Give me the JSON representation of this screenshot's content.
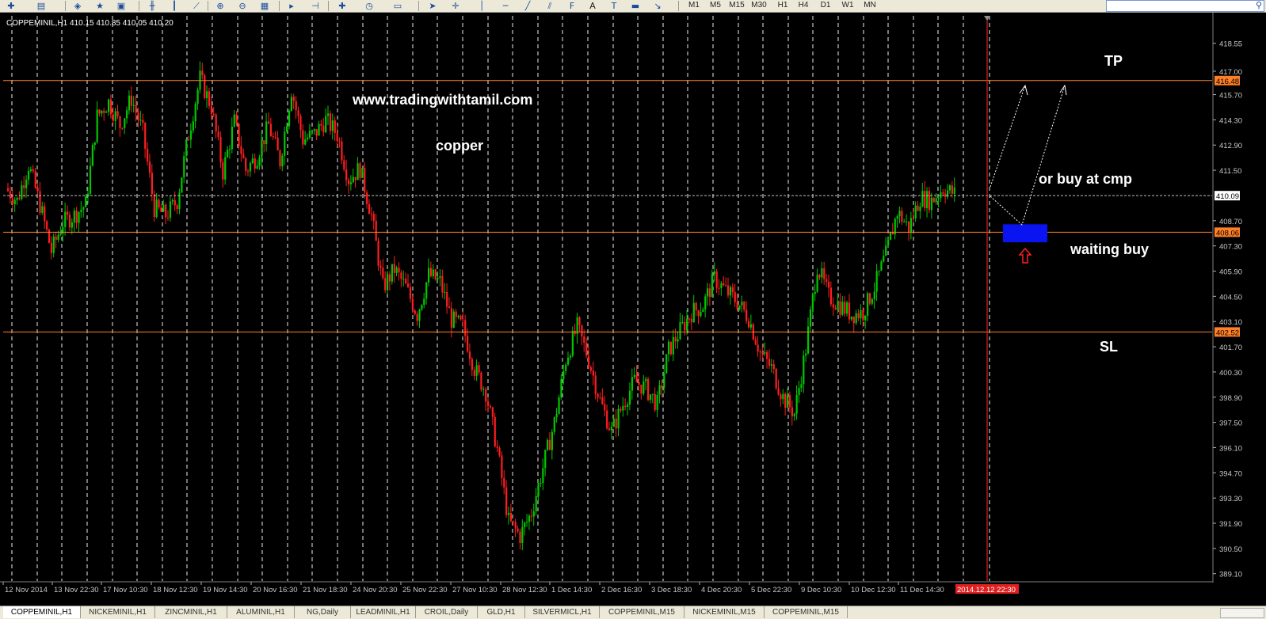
{
  "toolbar": {
    "timeframes": [
      "M1",
      "M5",
      "M15",
      "M30",
      "H1",
      "H4",
      "D1",
      "W1",
      "MN"
    ],
    "icons": [
      "new-chart-icon",
      "profiles-icon",
      "market-watch-icon",
      "favorites-icon",
      "navigator-icon",
      "bar-chart-icon",
      "candle-chart-icon",
      "line-chart-icon",
      "zoom-in-icon",
      "zoom-out-icon",
      "tile-icon",
      "auto-scroll-icon",
      "chart-shift-icon",
      "indicators-icon",
      "periods-icon",
      "templates-icon",
      "cursor-icon",
      "crosshair-icon",
      "vertical-line-icon",
      "horizontal-line-icon",
      "trendline-icon",
      "equidistant-channel-icon",
      "fibonacci-icon",
      "text-icon",
      "text-label-icon",
      "rectangle-icon",
      "arrows-icon"
    ],
    "text_tool_label": "A",
    "fib_label": "F"
  },
  "chart": {
    "info_label": "COPPEMINIL,H1  410.15 410.85 410.05 410.20",
    "colors": {
      "background": "#000000",
      "bull_candle": "#00c800",
      "bear_candle": "#ff1e1e",
      "grid": "#d8d8d8",
      "level_line": "#ff7f27",
      "bid_line": "#c0c0c0",
      "period_separator": "#dd2020",
      "entry_zone": "#0a14f0",
      "axis_text": "#c8c8c8",
      "axis_bg": "#000000",
      "price_marker_bg": "#ff7f27",
      "bid_marker_bg": "#ffffff",
      "time_marker_bg": "#e02020"
    },
    "y_axis": {
      "min": 388.9,
      "max": 419.6,
      "ticks": [
        "418.55",
        "417.00",
        "415.70",
        "414.30",
        "412.90",
        "411.50",
        "410.09",
        "408.70",
        "408.06",
        "407.30",
        "405.90",
        "404.50",
        "403.10",
        "402.52",
        "401.70",
        "400.30",
        "398.90",
        "397.50",
        "396.10",
        "394.70",
        "393.30",
        "391.90",
        "390.50",
        "389.10"
      ],
      "highlighted": [
        {
          "price": 416.48,
          "label": "416.48",
          "kind": "level"
        },
        {
          "price": 410.09,
          "label": "410.09",
          "kind": "bid"
        },
        {
          "price": 408.06,
          "label": "408.06",
          "kind": "level"
        },
        {
          "price": 402.52,
          "label": "402.52",
          "kind": "level"
        }
      ]
    },
    "x_axis": {
      "labels": [
        "12 Nov 2014",
        "13 Nov 22:30",
        "17 Nov 10:30",
        "18 Nov 12:30",
        "19 Nov 14:30",
        "20 Nov 16:30",
        "21 Nov 18:30",
        "24 Nov 20:30",
        "25 Nov 22:30",
        "27 Nov 10:30",
        "28 Nov 12:30",
        "1 Dec 14:30",
        "2 Dec 16:30",
        "3 Dec 18:30",
        "4 Dec 20:30",
        "5 Dec 22:30",
        "9 Dec 10:30",
        "10 Dec 12:30",
        "11 Dec 14:30"
      ],
      "current_time_label": "2014.12.12 22:30"
    },
    "annotations": {
      "website": "www.tradingwithtamil.com",
      "symbol_note": "copper",
      "tp": "TP",
      "buy_cmp": "or buy at cmp",
      "waiting_buy": "waiting buy",
      "sl": "SL"
    },
    "levels": {
      "tp": 416.48,
      "entry": 408.06,
      "sl": 402.52,
      "bid": 410.09,
      "entry_zone": [
        407.5,
        408.5
      ]
    },
    "chart_data": {
      "type": "candlestick",
      "symbol": "COPPEMINIL",
      "timeframe": "H1",
      "last_bar": {
        "open": 410.15,
        "high": 410.85,
        "low": 410.05,
        "close": 410.2
      },
      "path_close": [
        410.5,
        409.8,
        411.8,
        409.6,
        407.0,
        408.6,
        409.0,
        409.6,
        414.5,
        415.3,
        414.0,
        415.5,
        413.6,
        409.4,
        409.0,
        409.8,
        413.5,
        416.6,
        415.0,
        411.4,
        414.2,
        411.5,
        412.3,
        414.0,
        412.0,
        416.0,
        413.2,
        413.5,
        414.3,
        413.5,
        411.0,
        411.6,
        409.0,
        405.0,
        406.0,
        405.0,
        403.5,
        405.7,
        405.3,
        403.2,
        402.8,
        400.5,
        399.2,
        396.0,
        392.0,
        391.2,
        392.5,
        395.0,
        397.5,
        401.0,
        402.8,
        401.0,
        398.7,
        397.0,
        398.5,
        399.8,
        399.4,
        398.5,
        401.5,
        402.6,
        403.6,
        404.0,
        405.5,
        404.8,
        404.2,
        403.3,
        401.4,
        400.5,
        398.9,
        398.0,
        401.6,
        406.2,
        404.5,
        404.0,
        403.5,
        403.6,
        405.0,
        406.8,
        409.2,
        408.3,
        410.0,
        409.8,
        410.5,
        410.2
      ]
    }
  },
  "bottom_tabs": [
    "COPPEMINIL,H1",
    "NICKEMINIL,H1",
    "ZINCMINIL,H1",
    "ALUMINIL,H1",
    "NG,Daily",
    "LEADMINIL,H1",
    "CROIL,Daily",
    "GLD,H1",
    "SILVERMICL,H1",
    "COPPEMINIL,M15",
    "NICKEMINIL,M15",
    "COPPEMINIL,M15"
  ]
}
